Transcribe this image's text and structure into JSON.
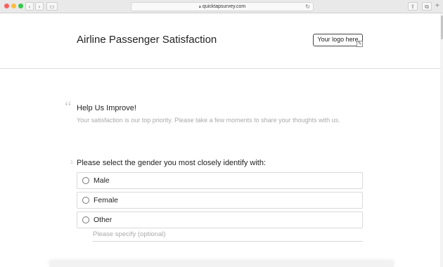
{
  "browser": {
    "url": "quicktapsurvey.com",
    "back_icon": "chevron-left-icon",
    "forward_icon": "chevron-right-icon",
    "lock_icon": "lock-icon",
    "reload_icon": "reload-icon",
    "share_icon": "share-icon",
    "tabs_icon": "tabs-icon",
    "new_tab_icon": "plus-icon"
  },
  "header": {
    "title": "Airline Passenger Satisfaction",
    "logo_placeholder": "Your logo here"
  },
  "intro": {
    "heading": "Help Us Improve!",
    "text": "Your satisfaction is our top priority. Please take a few moments to share your thoughts with us."
  },
  "question": {
    "label": "Please select the gender you most closely identify with:",
    "options": [
      {
        "label": "Male",
        "selected": false
      },
      {
        "label": "Female",
        "selected": false
      },
      {
        "label": "Other",
        "selected": false
      }
    ],
    "specify_placeholder": "Please specify (optional)"
  }
}
